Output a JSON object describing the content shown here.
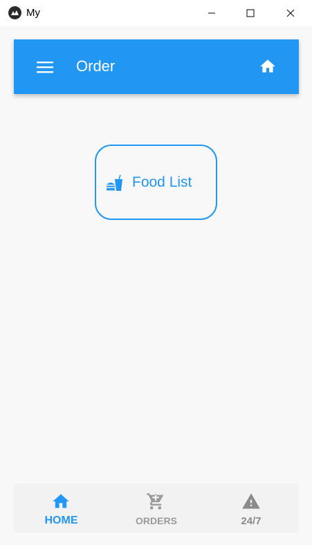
{
  "window": {
    "title": "My"
  },
  "toolbar": {
    "title": "Order",
    "left_icon": "menu-icon",
    "right_icon": "home-icon",
    "color": "#2196f3"
  },
  "main": {
    "food_button": {
      "label": "Food List",
      "icon": "food-icon"
    }
  },
  "bottom_nav": {
    "items": [
      {
        "label": "HOME",
        "icon": "home-icon",
        "active": true
      },
      {
        "label": "ORDERS",
        "icon": "cart-icon",
        "active": false
      },
      {
        "label": "24/7",
        "icon": "warning-icon",
        "active": false
      }
    ],
    "active_color": "#2196f3",
    "inactive_color": "#9a9a9a"
  }
}
